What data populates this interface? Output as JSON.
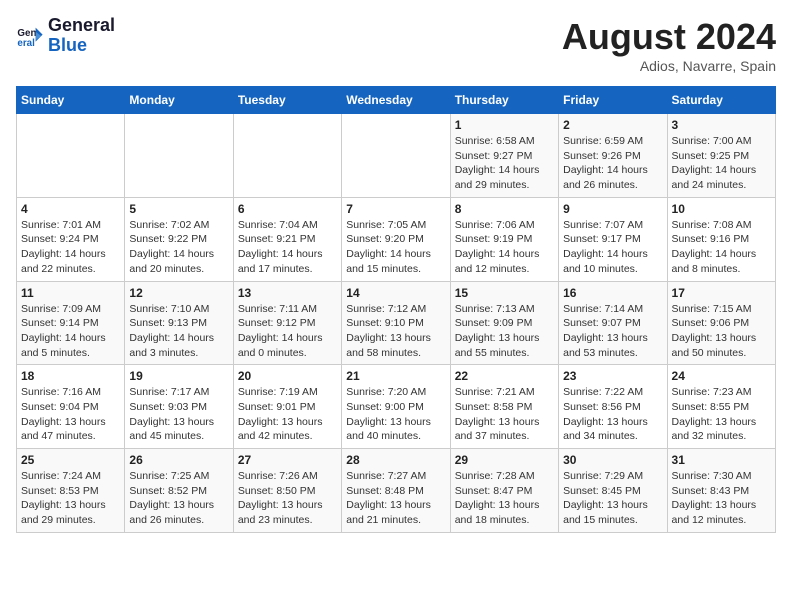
{
  "header": {
    "logo_general": "General",
    "logo_blue": "Blue",
    "month_title": "August 2024",
    "subtitle": "Adios, Navarre, Spain"
  },
  "calendar": {
    "days_of_week": [
      "Sunday",
      "Monday",
      "Tuesday",
      "Wednesday",
      "Thursday",
      "Friday",
      "Saturday"
    ],
    "weeks": [
      [
        {
          "day": "",
          "info": ""
        },
        {
          "day": "",
          "info": ""
        },
        {
          "day": "",
          "info": ""
        },
        {
          "day": "",
          "info": ""
        },
        {
          "day": "1",
          "info": "Sunrise: 6:58 AM\nSunset: 9:27 PM\nDaylight: 14 hours and 29 minutes."
        },
        {
          "day": "2",
          "info": "Sunrise: 6:59 AM\nSunset: 9:26 PM\nDaylight: 14 hours and 26 minutes."
        },
        {
          "day": "3",
          "info": "Sunrise: 7:00 AM\nSunset: 9:25 PM\nDaylight: 14 hours and 24 minutes."
        }
      ],
      [
        {
          "day": "4",
          "info": "Sunrise: 7:01 AM\nSunset: 9:24 PM\nDaylight: 14 hours and 22 minutes."
        },
        {
          "day": "5",
          "info": "Sunrise: 7:02 AM\nSunset: 9:22 PM\nDaylight: 14 hours and 20 minutes."
        },
        {
          "day": "6",
          "info": "Sunrise: 7:04 AM\nSunset: 9:21 PM\nDaylight: 14 hours and 17 minutes."
        },
        {
          "day": "7",
          "info": "Sunrise: 7:05 AM\nSunset: 9:20 PM\nDaylight: 14 hours and 15 minutes."
        },
        {
          "day": "8",
          "info": "Sunrise: 7:06 AM\nSunset: 9:19 PM\nDaylight: 14 hours and 12 minutes."
        },
        {
          "day": "9",
          "info": "Sunrise: 7:07 AM\nSunset: 9:17 PM\nDaylight: 14 hours and 10 minutes."
        },
        {
          "day": "10",
          "info": "Sunrise: 7:08 AM\nSunset: 9:16 PM\nDaylight: 14 hours and 8 minutes."
        }
      ],
      [
        {
          "day": "11",
          "info": "Sunrise: 7:09 AM\nSunset: 9:14 PM\nDaylight: 14 hours and 5 minutes."
        },
        {
          "day": "12",
          "info": "Sunrise: 7:10 AM\nSunset: 9:13 PM\nDaylight: 14 hours and 3 minutes."
        },
        {
          "day": "13",
          "info": "Sunrise: 7:11 AM\nSunset: 9:12 PM\nDaylight: 14 hours and 0 minutes."
        },
        {
          "day": "14",
          "info": "Sunrise: 7:12 AM\nSunset: 9:10 PM\nDaylight: 13 hours and 58 minutes."
        },
        {
          "day": "15",
          "info": "Sunrise: 7:13 AM\nSunset: 9:09 PM\nDaylight: 13 hours and 55 minutes."
        },
        {
          "day": "16",
          "info": "Sunrise: 7:14 AM\nSunset: 9:07 PM\nDaylight: 13 hours and 53 minutes."
        },
        {
          "day": "17",
          "info": "Sunrise: 7:15 AM\nSunset: 9:06 PM\nDaylight: 13 hours and 50 minutes."
        }
      ],
      [
        {
          "day": "18",
          "info": "Sunrise: 7:16 AM\nSunset: 9:04 PM\nDaylight: 13 hours and 47 minutes."
        },
        {
          "day": "19",
          "info": "Sunrise: 7:17 AM\nSunset: 9:03 PM\nDaylight: 13 hours and 45 minutes."
        },
        {
          "day": "20",
          "info": "Sunrise: 7:19 AM\nSunset: 9:01 PM\nDaylight: 13 hours and 42 minutes."
        },
        {
          "day": "21",
          "info": "Sunrise: 7:20 AM\nSunset: 9:00 PM\nDaylight: 13 hours and 40 minutes."
        },
        {
          "day": "22",
          "info": "Sunrise: 7:21 AM\nSunset: 8:58 PM\nDaylight: 13 hours and 37 minutes."
        },
        {
          "day": "23",
          "info": "Sunrise: 7:22 AM\nSunset: 8:56 PM\nDaylight: 13 hours and 34 minutes."
        },
        {
          "day": "24",
          "info": "Sunrise: 7:23 AM\nSunset: 8:55 PM\nDaylight: 13 hours and 32 minutes."
        }
      ],
      [
        {
          "day": "25",
          "info": "Sunrise: 7:24 AM\nSunset: 8:53 PM\nDaylight: 13 hours and 29 minutes."
        },
        {
          "day": "26",
          "info": "Sunrise: 7:25 AM\nSunset: 8:52 PM\nDaylight: 13 hours and 26 minutes."
        },
        {
          "day": "27",
          "info": "Sunrise: 7:26 AM\nSunset: 8:50 PM\nDaylight: 13 hours and 23 minutes."
        },
        {
          "day": "28",
          "info": "Sunrise: 7:27 AM\nSunset: 8:48 PM\nDaylight: 13 hours and 21 minutes."
        },
        {
          "day": "29",
          "info": "Sunrise: 7:28 AM\nSunset: 8:47 PM\nDaylight: 13 hours and 18 minutes."
        },
        {
          "day": "30",
          "info": "Sunrise: 7:29 AM\nSunset: 8:45 PM\nDaylight: 13 hours and 15 minutes."
        },
        {
          "day": "31",
          "info": "Sunrise: 7:30 AM\nSunset: 8:43 PM\nDaylight: 13 hours and 12 minutes."
        }
      ]
    ]
  }
}
